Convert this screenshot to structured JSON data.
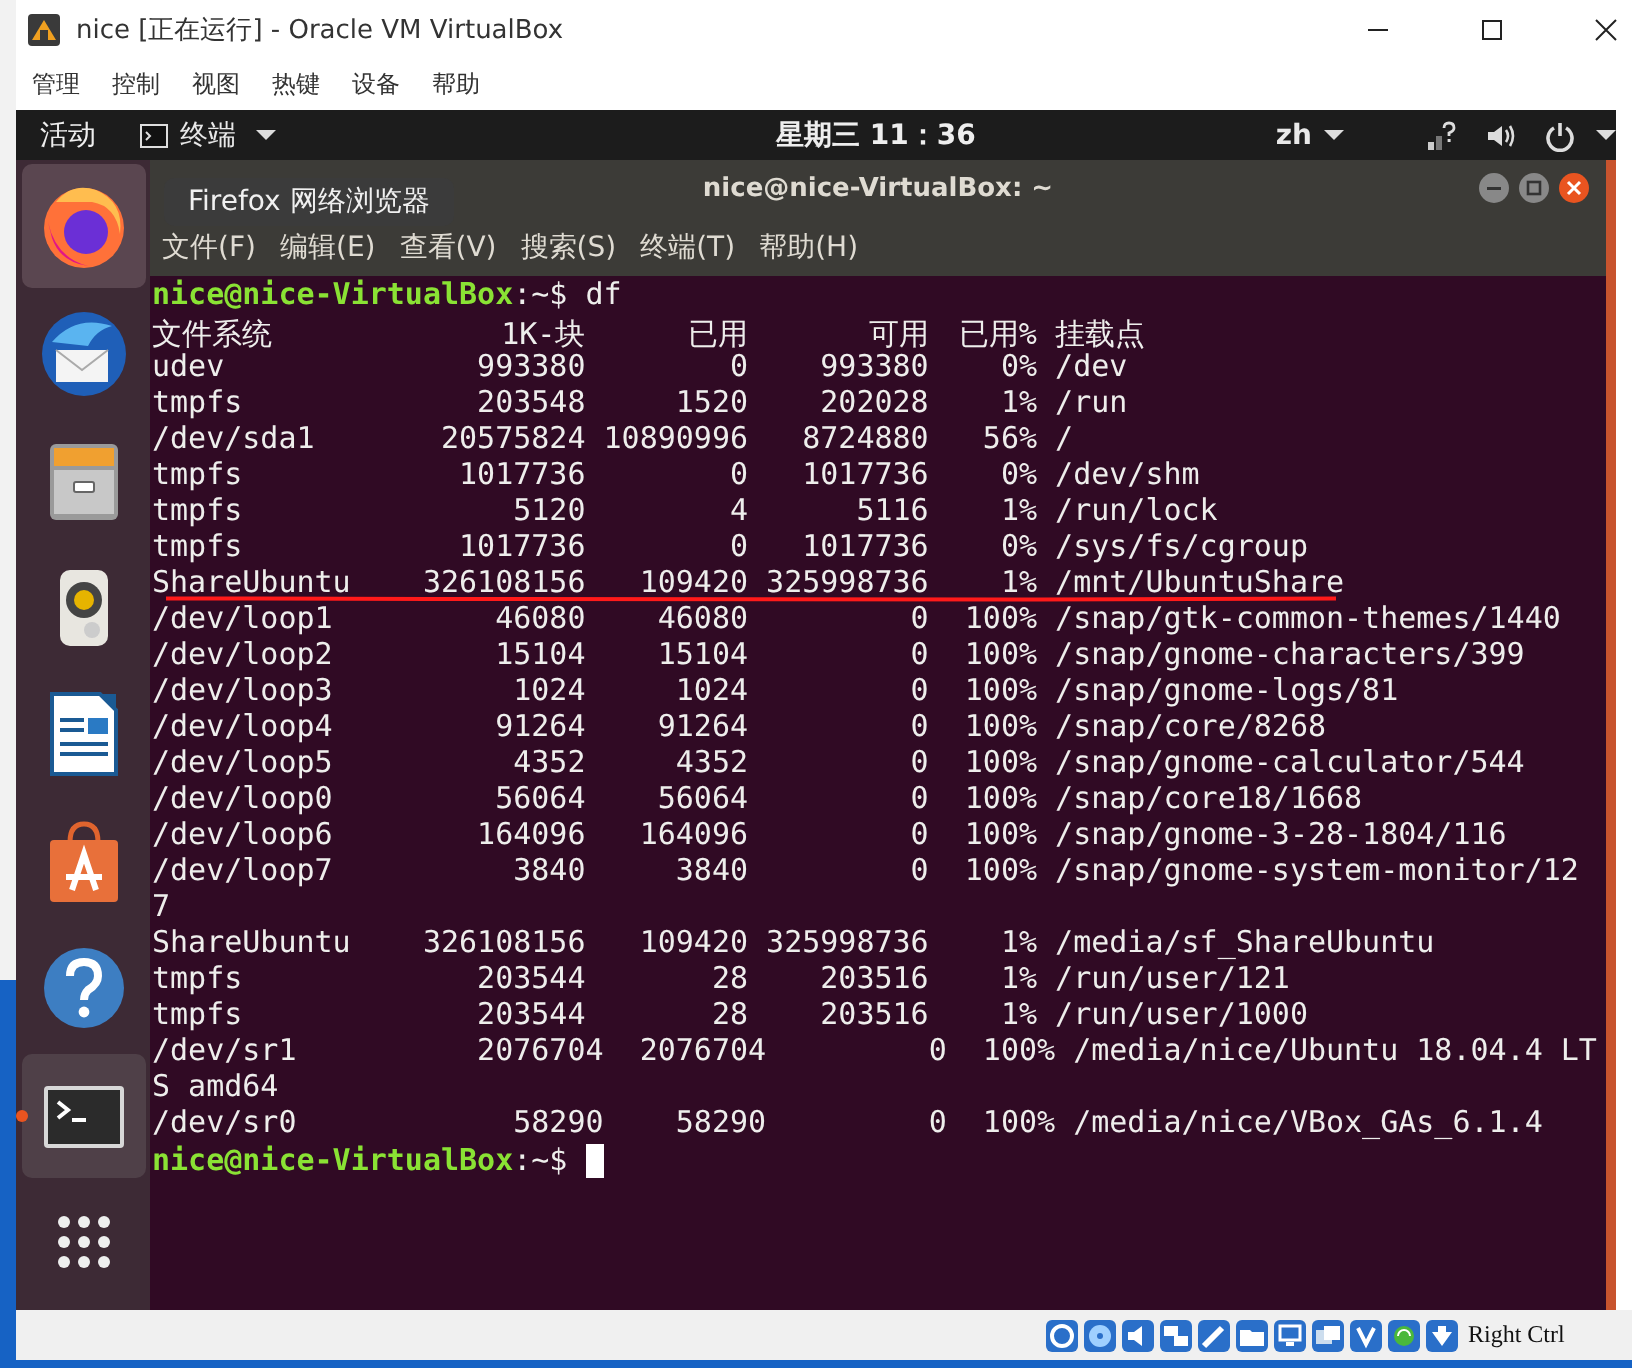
{
  "window": {
    "title": "nice [正在运行] - Oracle VM VirtualBox"
  },
  "menu": [
    "管理",
    "控制",
    "视图",
    "热键",
    "设备",
    "帮助"
  ],
  "top_bar": {
    "activities": "活动",
    "app_menu": "终端",
    "clock": "星期三 11：36",
    "input_method": "zh"
  },
  "dock": [
    {
      "kind": "browser",
      "hovered": true,
      "focused": false,
      "running": false
    },
    {
      "kind": "mail",
      "hovered": false,
      "focused": false,
      "running": false
    },
    {
      "kind": "files",
      "hovered": false,
      "focused": false,
      "running": false
    },
    {
      "kind": "music",
      "hovered": false,
      "focused": false,
      "running": false
    },
    {
      "kind": "writer",
      "hovered": false,
      "focused": false,
      "running": false
    },
    {
      "kind": "store",
      "hovered": false,
      "focused": false,
      "running": false
    },
    {
      "kind": "help",
      "hovered": false,
      "focused": false,
      "running": false
    },
    {
      "kind": "terminal",
      "hovered": false,
      "focused": true,
      "running": true
    },
    {
      "kind": "apps",
      "hovered": false,
      "focused": false,
      "running": false
    }
  ],
  "tooltip": "Firefox 网络浏览器",
  "terminal": {
    "title": "nice@nice-VirtualBox: ~",
    "menu": [
      "文件(F)",
      "编辑(E)",
      "查看(V)",
      "搜索(S)",
      "终端(T)",
      "帮助(H)"
    ],
    "lines": [
      {
        "kind": "prompt",
        "prompt": "nice@nice-VirtualBox",
        "text": ":~$ df",
        "cursor": false
      },
      {
        "kind": "header",
        "cells": [
          "文件系统",
          "1K-块",
          "已用",
          "可用",
          "已用%",
          "挂载点"
        ]
      },
      {
        "kind": "output",
        "text": "udev              993380        0    993380    0% /dev"
      },
      {
        "kind": "output",
        "text": "tmpfs             203548     1520    202028    1% /run"
      },
      {
        "kind": "output",
        "text": "/dev/sda1       20575824 10890996   8724880   56% /"
      },
      {
        "kind": "output",
        "text": "tmpfs            1017736        0   1017736    0% /dev/shm"
      },
      {
        "kind": "output",
        "text": "tmpfs               5120        4      5116    1% /run/lock"
      },
      {
        "kind": "output",
        "text": "tmpfs            1017736        0   1017736    0% /sys/fs/cgroup"
      },
      {
        "kind": "output",
        "text": "ShareUbuntu    326108156   109420 325998736    1% /mnt/UbuntuShare"
      },
      {
        "kind": "output",
        "text": "/dev/loop1         46080    46080         0  100% /snap/gtk-common-themes/1440"
      },
      {
        "kind": "output",
        "text": "/dev/loop2         15104    15104         0  100% /snap/gnome-characters/399"
      },
      {
        "kind": "output",
        "text": "/dev/loop3          1024     1024         0  100% /snap/gnome-logs/81"
      },
      {
        "kind": "output",
        "text": "/dev/loop4         91264    91264         0  100% /snap/core/8268"
      },
      {
        "kind": "output",
        "text": "/dev/loop5          4352     4352         0  100% /snap/gnome-calculator/544"
      },
      {
        "kind": "output",
        "text": "/dev/loop0         56064    56064         0  100% /snap/core18/1668"
      },
      {
        "kind": "output",
        "text": "/dev/loop6        164096   164096         0  100% /snap/gnome-3-28-1804/116"
      },
      {
        "kind": "output",
        "text": "/dev/loop7          3840     3840         0  100% /snap/gnome-system-monitor/12"
      },
      {
        "kind": "output",
        "text": "7"
      },
      {
        "kind": "output",
        "text": "ShareUbuntu    326108156   109420 325998736    1% /media/sf_ShareUbuntu"
      },
      {
        "kind": "output",
        "text": "tmpfs             203544       28    203516    1% /run/user/121"
      },
      {
        "kind": "output",
        "text": "tmpfs             203544       28    203516    1% /run/user/1000"
      },
      {
        "kind": "output",
        "text": "/dev/sr1          2076704  2076704         0  100% /media/nice/Ubuntu 18.04.4 LT"
      },
      {
        "kind": "output",
        "text": "S amd64"
      },
      {
        "kind": "output",
        "text": "/dev/sr0            58290    58290         0  100% /media/nice/VBox_GAs_6.1.4"
      },
      {
        "kind": "prompt",
        "prompt": "nice@nice-VirtualBox",
        "text": ":~$",
        "cursor": true
      }
    ]
  },
  "status_bar": {
    "host_key": "Right Ctrl"
  }
}
